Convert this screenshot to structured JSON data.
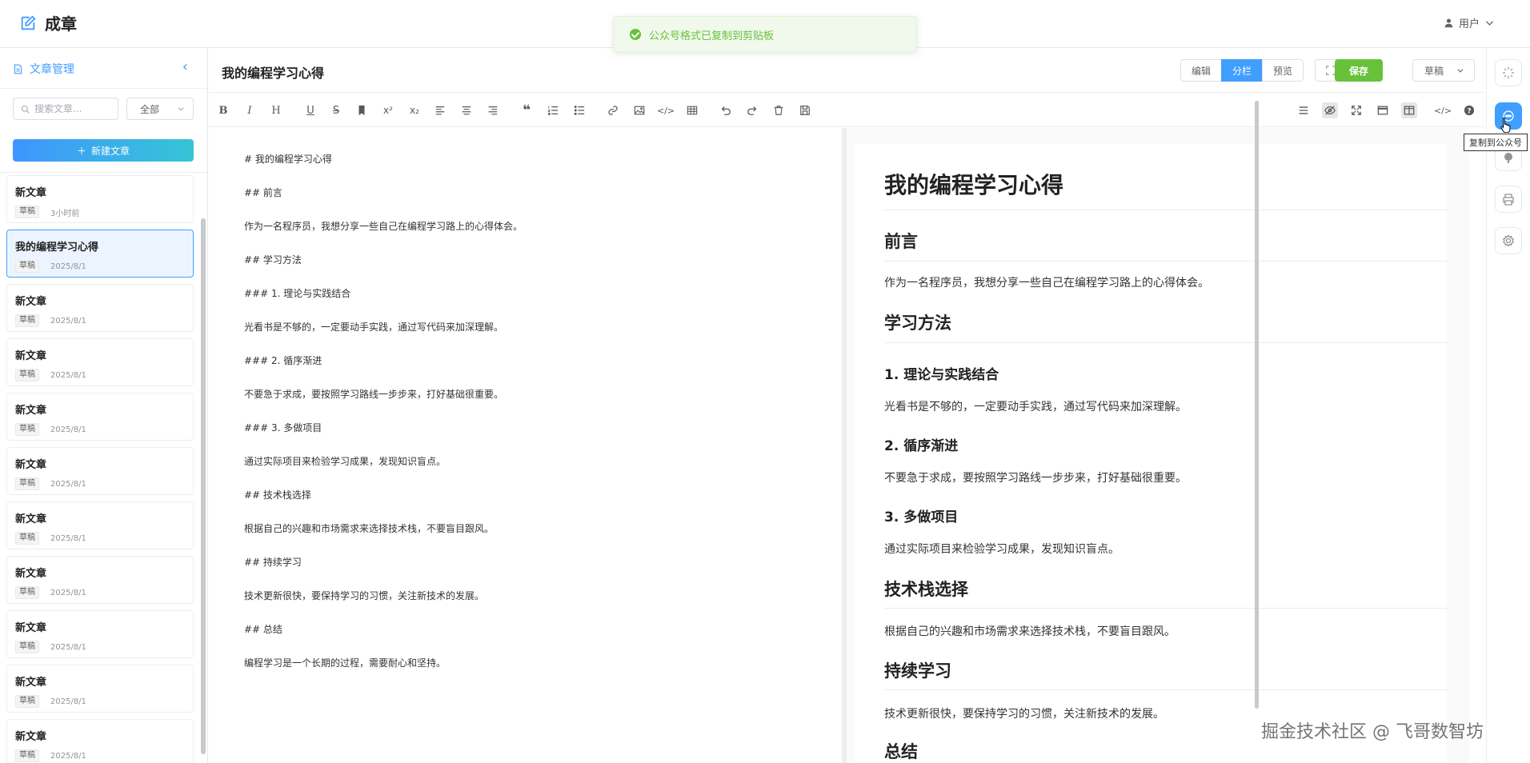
{
  "app": {
    "title": "成章",
    "user_label": "用户"
  },
  "toast": {
    "text": "公众号格式已复制到剪贴板"
  },
  "sidebar": {
    "title": "文章管理",
    "search_placeholder": "搜索文章...",
    "filter_value": "全部",
    "new_button": "新建文章",
    "articles": [
      {
        "title": "新文章",
        "tag": "草稿",
        "date": "3小时前"
      },
      {
        "title": "我的编程学习心得",
        "tag": "草稿",
        "date": "2025/8/1"
      },
      {
        "title": "新文章",
        "tag": "草稿",
        "date": "2025/8/1"
      },
      {
        "title": "新文章",
        "tag": "草稿",
        "date": "2025/8/1"
      },
      {
        "title": "新文章",
        "tag": "草稿",
        "date": "2025/8/1"
      },
      {
        "title": "新文章",
        "tag": "草稿",
        "date": "2025/8/1"
      },
      {
        "title": "新文章",
        "tag": "草稿",
        "date": "2025/8/1"
      },
      {
        "title": "新文章",
        "tag": "草稿",
        "date": "2025/8/1"
      },
      {
        "title": "新文章",
        "tag": "草稿",
        "date": "2025/8/1"
      },
      {
        "title": "新文章",
        "tag": "草稿",
        "date": "2025/8/1"
      },
      {
        "title": "新文章",
        "tag": "草稿",
        "date": "2025/8/1"
      }
    ]
  },
  "editor_header": {
    "doc_title": "我的编程学习心得",
    "modes": [
      "编辑",
      "分栏",
      "预览"
    ],
    "active_mode": "分栏",
    "save_label": "保存",
    "status_value": "草稿"
  },
  "markdown_lines": [
    "# 我的编程学习心得",
    "## 前言",
    "作为一名程序员，我想分享一些自己在编程学习路上的心得体会。",
    "## 学习方法",
    "### 1. 理论与实践结合",
    "光看书是不够的，一定要动手实践，通过写代码来加深理解。",
    "### 2. 循序渐进",
    "不要急于求成，要按照学习路线一步步来，打好基础很重要。",
    "### 3. 多做项目",
    "通过实际项目来检验学习成果，发现知识盲点。",
    "## 技术栈选择",
    "根据自己的兴趣和市场需求来选择技术栈，不要盲目跟风。",
    "## 持续学习",
    "技术更新很快，要保持学习的习惯，关注新技术的发展。",
    "## 总结",
    "编程学习是一个长期的过程，需要耐心和坚持。"
  ],
  "preview": {
    "h1": "我的编程学习心得",
    "sections": [
      {
        "type": "h2",
        "text": "前言"
      },
      {
        "type": "p",
        "text": "作为一名程序员，我想分享一些自己在编程学习路上的心得体会。"
      },
      {
        "type": "h2",
        "text": "学习方法"
      },
      {
        "type": "h3",
        "text": "1. 理论与实践结合"
      },
      {
        "type": "p",
        "text": "光看书是不够的，一定要动手实践，通过写代码来加深理解。"
      },
      {
        "type": "h3",
        "text": "2. 循序渐进"
      },
      {
        "type": "p",
        "text": "不要急于求成，要按照学习路线一步步来，打好基础很重要。"
      },
      {
        "type": "h3",
        "text": "3. 多做项目"
      },
      {
        "type": "p",
        "text": "通过实际项目来检验学习成果，发现知识盲点。"
      },
      {
        "type": "h2",
        "text": "技术栈选择"
      },
      {
        "type": "p",
        "text": "根据自己的兴趣和市场需求来选择技术栈，不要盲目跟风。"
      },
      {
        "type": "h2",
        "text": "持续学习"
      },
      {
        "type": "p",
        "text": "技术更新很快，要保持学习的习惯，关注新技术的发展。"
      },
      {
        "type": "h2",
        "text": "总结"
      }
    ]
  },
  "rail": {
    "tooltip": "复制到公众号"
  },
  "watermark": "掘金技术社区 @ 飞哥数智坊",
  "colors": {
    "primary": "#409eff",
    "success": "#67c23a"
  }
}
